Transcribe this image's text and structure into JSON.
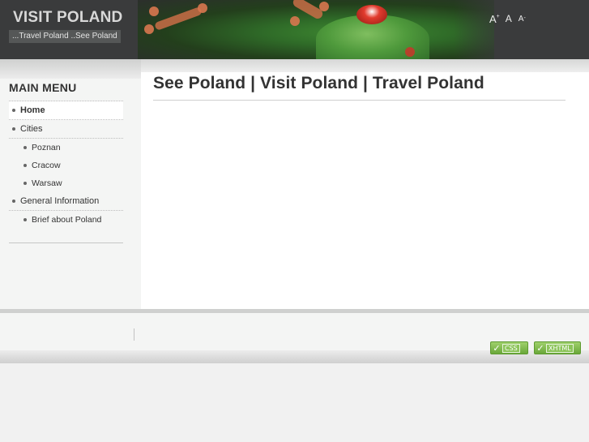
{
  "header": {
    "site_title": "VISIT POLAND",
    "slogan": "...Travel Poland ..See Poland",
    "font_tools": {
      "increase": "A",
      "increase_mark": "+",
      "normal": "A",
      "decrease": "A",
      "decrease_mark": "-"
    }
  },
  "sidebar": {
    "title": "MAIN MENU",
    "items": [
      {
        "label": "Home",
        "level": 1,
        "active": true
      },
      {
        "label": "Cities",
        "level": 1
      },
      {
        "label": "Poznan",
        "level": 2
      },
      {
        "label": "Cracow",
        "level": 2
      },
      {
        "label": "Warsaw",
        "level": 2
      },
      {
        "label": "General Information",
        "level": 1
      },
      {
        "label": "Brief about Poland",
        "level": 2
      }
    ]
  },
  "main": {
    "title": "See Poland | Visit Poland | Travel Poland"
  },
  "footer": {
    "badges": {
      "css": "CSS",
      "xhtml": "XHTML"
    }
  },
  "colors": {
    "header_bg": "#3a3b3c",
    "frog_green": "#4f9a3c",
    "badge_green": "#7ab648"
  }
}
